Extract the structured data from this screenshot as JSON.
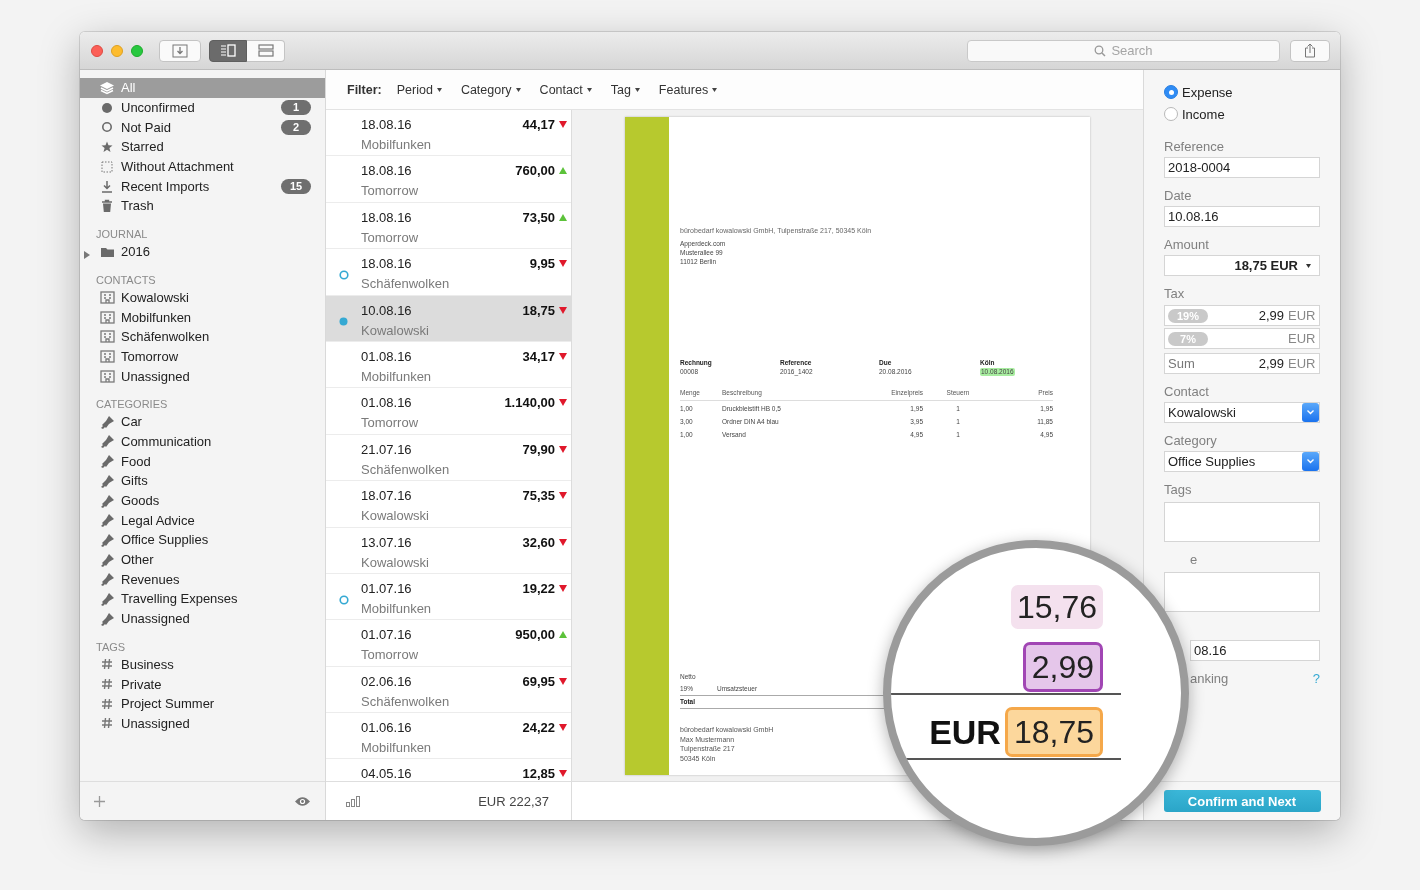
{
  "window": {
    "view_toggle": [
      {
        "selected": true
      },
      {
        "selected": false
      }
    ],
    "search": {
      "placeholder": "Search"
    }
  },
  "sidebar": {
    "smart_items": [
      {
        "label": "All",
        "selected": true
      },
      {
        "label": "Unconfirmed",
        "count": "1",
        "selected": false
      },
      {
        "label": "Not Paid",
        "count": "2",
        "selected": false
      },
      {
        "label": "Starred",
        "selected": false
      },
      {
        "label": "Without Attachment",
        "selected": false
      },
      {
        "label": "Recent Imports",
        "count": "15",
        "selected": false
      },
      {
        "label": "Trash",
        "selected": false
      }
    ],
    "sections": [
      {
        "title": "JOURNAL",
        "items": [
          {
            "label": "2016",
            "expanded": false
          }
        ]
      },
      {
        "title": "CONTACTS",
        "items": [
          {
            "label": "Kowalowski"
          },
          {
            "label": "Mobilfunken"
          },
          {
            "label": "Schäfenwolken"
          },
          {
            "label": "Tomorrow"
          },
          {
            "label": "Unassigned"
          }
        ]
      },
      {
        "title": "CATEGORIES",
        "items": [
          {
            "label": "Car"
          },
          {
            "label": "Communication"
          },
          {
            "label": "Food"
          },
          {
            "label": "Gifts"
          },
          {
            "label": "Goods"
          },
          {
            "label": "Legal Advice"
          },
          {
            "label": "Office Supplies"
          },
          {
            "label": "Other"
          },
          {
            "label": "Revenues"
          },
          {
            "label": "Travelling Expenses"
          },
          {
            "label": "Unassigned"
          }
        ]
      },
      {
        "title": "TAGS",
        "items": [
          {
            "label": "Business"
          },
          {
            "label": "Private"
          },
          {
            "label": "Project Summer"
          },
          {
            "label": "Unassigned"
          }
        ]
      }
    ]
  },
  "filter": {
    "label": "Filter:",
    "menus": [
      "Period",
      "Category",
      "Contact",
      "Tag",
      "Features"
    ]
  },
  "transactions": [
    {
      "date": "18.08.16",
      "contact": "Mobilfunken",
      "amount": "44,17",
      "income": false,
      "paid": true,
      "confirmed": true,
      "selected": false
    },
    {
      "date": "18.08.16",
      "contact": "Tomorrow",
      "amount": "760,00",
      "income": true,
      "paid": true,
      "confirmed": true,
      "selected": false
    },
    {
      "date": "18.08.16",
      "contact": "Tomorrow",
      "amount": "73,50",
      "income": true,
      "paid": true,
      "confirmed": true,
      "selected": false
    },
    {
      "date": "18.08.16",
      "contact": "Schäfenwolken",
      "amount": "9,95",
      "income": false,
      "paid": false,
      "confirmed": true,
      "selected": false
    },
    {
      "date": "10.08.16",
      "contact": "Kowalowski",
      "amount": "18,75",
      "income": false,
      "paid": true,
      "confirmed": false,
      "selected": true
    },
    {
      "date": "01.08.16",
      "contact": "Mobilfunken",
      "amount": "34,17",
      "income": false,
      "paid": true,
      "confirmed": true,
      "selected": false
    },
    {
      "date": "01.08.16",
      "contact": "Tomorrow",
      "amount": "1.140,00",
      "income": false,
      "paid": true,
      "confirmed": true,
      "selected": false
    },
    {
      "date": "21.07.16",
      "contact": "Schäfenwolken",
      "amount": "79,90",
      "income": false,
      "paid": true,
      "confirmed": true,
      "selected": false
    },
    {
      "date": "18.07.16",
      "contact": "Kowalowski",
      "amount": "75,35",
      "income": false,
      "paid": true,
      "confirmed": true,
      "selected": false
    },
    {
      "date": "13.07.16",
      "contact": "Kowalowski",
      "amount": "32,60",
      "income": false,
      "paid": true,
      "confirmed": true,
      "selected": false
    },
    {
      "date": "01.07.16",
      "contact": "Mobilfunken",
      "amount": "19,22",
      "income": false,
      "paid": false,
      "confirmed": true,
      "selected": false
    },
    {
      "date": "01.07.16",
      "contact": "Tomorrow",
      "amount": "950,00",
      "income": true,
      "paid": true,
      "confirmed": true,
      "selected": false
    },
    {
      "date": "02.06.16",
      "contact": "Schäfenwolken",
      "amount": "69,95",
      "income": false,
      "paid": true,
      "confirmed": true,
      "selected": false
    },
    {
      "date": "01.06.16",
      "contact": "Mobilfunken",
      "amount": "24,22",
      "income": false,
      "paid": true,
      "confirmed": true,
      "selected": false
    },
    {
      "date": "04.05.16",
      "amount": "12,85",
      "income": false,
      "paid": true,
      "confirmed": true,
      "selected": false
    }
  ],
  "list_footer": {
    "total": "EUR 222,37"
  },
  "document": {
    "sender_line": "bürobedarf kowalowski GmbH, Tulpenstraße 217, 50345 Köln",
    "recipient": [
      "Apperdeck.com",
      "Musterallee 99",
      "11012 Berlin"
    ],
    "meta": [
      {
        "label": "Rechnung",
        "value": "00008",
        "highlighted": false
      },
      {
        "label": "Reference",
        "value": "2016_1402",
        "highlighted": false
      },
      {
        "label": "Due",
        "value": "20.08.2016",
        "highlighted": false
      },
      {
        "label": "Köln",
        "value": "10.08.2016",
        "highlighted": true
      }
    ],
    "columns": [
      "Menge",
      "Beschreibung",
      "Einzelpreis",
      "Steuern",
      "Preis"
    ],
    "rows": [
      [
        "1,00",
        "Druckbleistift HB 0,5",
        "1,95",
        "1",
        "1,95"
      ],
      [
        "3,00",
        "Ordner DIN A4 blau",
        "3,95",
        "1",
        "11,85"
      ],
      [
        "1,00",
        "Versand",
        "4,95",
        "1",
        "4,95"
      ]
    ],
    "totals": [
      {
        "kind": "line",
        "cells": [
          "Netto"
        ]
      },
      {
        "kind": "line",
        "cells": [
          "19%",
          "Umsatzsteuer"
        ]
      },
      {
        "kind": "total",
        "cells": [
          "Total"
        ]
      }
    ],
    "footer": [
      "bürobedarf kowalowski GmbH",
      "Max Mustermann",
      "Tulpenstraße 217",
      "50345 Köln"
    ]
  },
  "inspector": {
    "type_options": [
      {
        "label": "Expense",
        "selected": true
      },
      {
        "label": "Income",
        "selected": false
      }
    ],
    "fields": [
      {
        "kind": "text",
        "label": "Reference",
        "value": "2018-0004"
      },
      {
        "kind": "text",
        "label": "Date",
        "value": "10.08.16"
      },
      {
        "kind": "amount",
        "label": "Amount",
        "value": "18,75 EUR"
      },
      {
        "kind": "tax",
        "label": "Tax",
        "rows": [
          {
            "rate": "19%",
            "value": "2,99",
            "currency": "EUR"
          },
          {
            "rate": "7%",
            "currency": "EUR"
          }
        ],
        "sum": {
          "label": "Sum",
          "value": "2,99",
          "currency": "EUR"
        }
      },
      {
        "kind": "select",
        "label": "Contact",
        "value": "Kowalowski"
      },
      {
        "kind": "select",
        "label": "Category",
        "value": "Office Supplies"
      },
      {
        "kind": "area",
        "label": "Tags"
      },
      {
        "kind": "area",
        "label": "e"
      },
      {
        "kind": "text",
        "value": "08.16"
      },
      {
        "kind": "help",
        "label": "anking",
        "help": "?"
      }
    ],
    "button": "Confirm and Next"
  },
  "magnifier": {
    "values": [
      {
        "kind": "net",
        "text": "15,76"
      },
      {
        "kind": "tax",
        "text": "2,99"
      },
      {
        "kind": "total",
        "currency": "EUR",
        "text": "18,75"
      }
    ]
  }
}
